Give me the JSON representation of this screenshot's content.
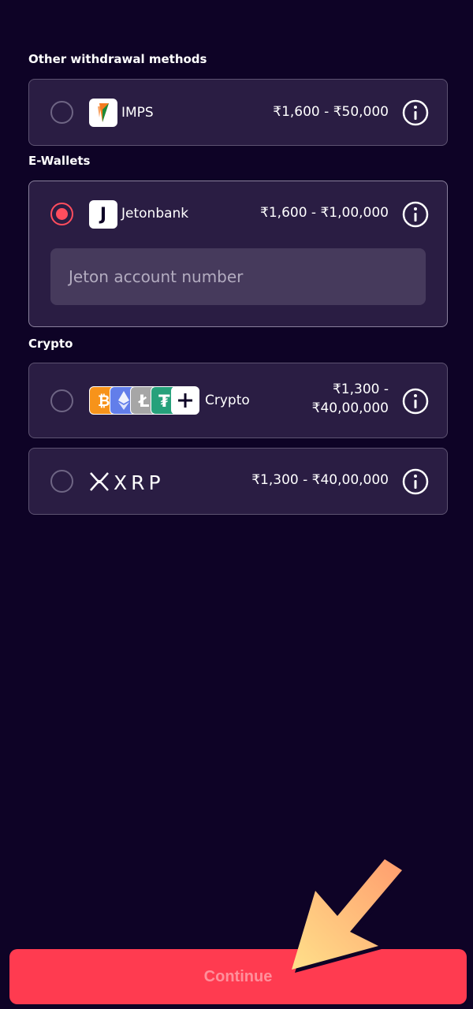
{
  "sections": {
    "other_title": "Other withdrawal methods",
    "ewallets_title": "E-Wallets",
    "crypto_title": "Crypto"
  },
  "methods": {
    "imps": {
      "name": "IMPS",
      "range": "₹1,600 - ₹50,000",
      "selected": false
    },
    "jetonbank": {
      "name": "Jetonbank",
      "range": "₹1,600 - ₹1,00,000",
      "selected": true,
      "logo_letter": "J",
      "input_placeholder": "Jeton account number"
    },
    "crypto": {
      "name": "Crypto",
      "range_line1": "₹1,300 -",
      "range_line2": "₹40,00,000",
      "selected": false,
      "coins": [
        "bitcoin-icon",
        "ethereum-icon",
        "litecoin-icon",
        "tether-icon",
        "plus-icon"
      ]
    },
    "xrp": {
      "name": "XRP",
      "range": "₹1,300 - ₹40,00,000",
      "selected": false
    }
  },
  "continue_label": "Continue",
  "colors": {
    "background": "#0e0326",
    "card": "#2a1d43",
    "accent": "#ff3b50",
    "radio_checked": "#ff4d5e"
  }
}
